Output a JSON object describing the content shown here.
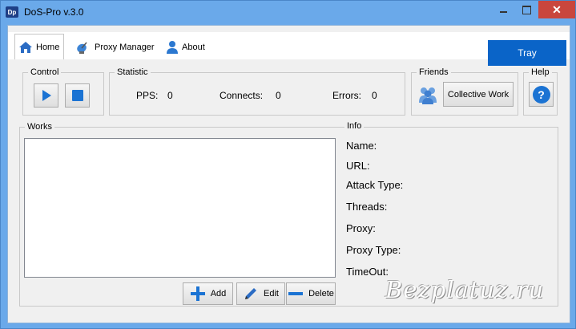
{
  "window": {
    "app_icon_text": "Dp",
    "title": "DoS-Pro v.3.0",
    "controls": {
      "minimize": "minimize",
      "maximize": "maximize",
      "close": "✕"
    }
  },
  "tabs": [
    {
      "label": "Home",
      "icon": "home-icon"
    },
    {
      "label": "Proxy Manager",
      "icon": "satellite-dish-icon"
    },
    {
      "label": "About",
      "icon": "user-icon"
    }
  ],
  "tray": {
    "label": "Tray"
  },
  "groups": {
    "control": "Control",
    "statistic": "Statistic",
    "friends": "Friends",
    "help": "Help",
    "works": "Works",
    "info": "Info"
  },
  "statistic": {
    "pps_label": "PPS:",
    "pps_value": "0",
    "connects_label": "Connects:",
    "connects_value": "0",
    "errors_label": "Errors:",
    "errors_value": "0"
  },
  "friends": {
    "button_label": "Collective Work",
    "icon": "people-group-icon"
  },
  "help": {
    "icon_text": "?"
  },
  "info": {
    "name": "Name:",
    "url": "URL:",
    "attack_type": "Attack Type:",
    "threads": "Threads:",
    "proxy": "Proxy:",
    "proxy_type": "Proxy Type:",
    "timeout": "TimeOut:"
  },
  "works_actions": {
    "add": "Add",
    "edit": "Edit",
    "delete": "Delete"
  },
  "watermark": "Bezplatuz.ru",
  "colors": {
    "accent": "#0a64c8",
    "window_frame": "#6aa9ea",
    "close": "#c9463d"
  }
}
